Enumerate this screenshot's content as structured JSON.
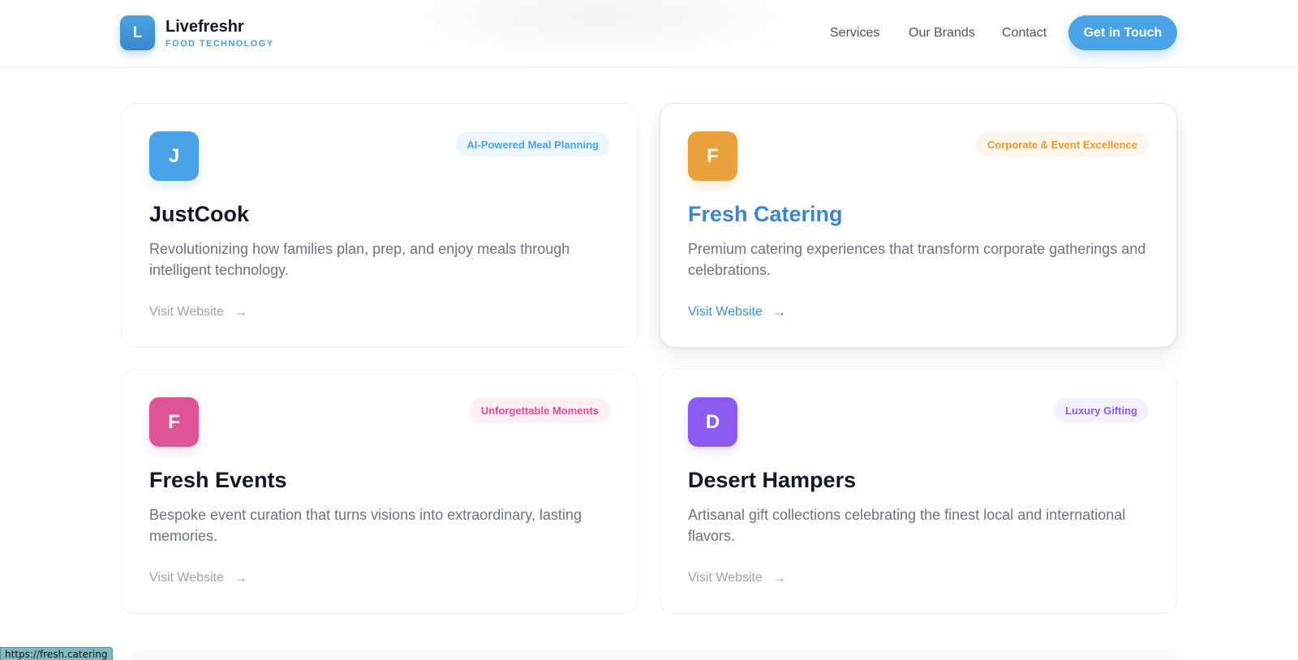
{
  "header": {
    "logo_letter": "L",
    "brand_name": "Livefreshr",
    "brand_tagline": "FOOD TECHNOLOGY",
    "nav": [
      "Services",
      "Our Brands",
      "Contact"
    ],
    "cta_label": "Get in Touch"
  },
  "cards": [
    {
      "letter": "J",
      "tag": "AI-Powered Meal Planning",
      "title": "JustCook",
      "description": "Revolutionizing how families plan, prep, and enjoy meals through intelligent technology.",
      "link": "Visit Website",
      "arrow": "→",
      "icon_color": "#4aa3e6",
      "tag_color": "#4aa3e6",
      "tag_bg": "#eef6fd",
      "state": "default"
    },
    {
      "letter": "F",
      "tag": "Corporate & Event Excellence",
      "title": "Fresh Catering",
      "description": "Premium catering experiences that transform corporate gatherings and celebrations.",
      "link": "Visit Website",
      "arrow": "→",
      "icon_color": "#e9a23b",
      "tag_color": "#e79a35",
      "tag_bg": "#fef6ea",
      "state": "hovered"
    },
    {
      "letter": "F",
      "tag": "Unforgettable Moments",
      "title": "Fresh Events",
      "description": "Bespoke event curation that turns visions into extraordinary, lasting memories.",
      "link": "Visit Website",
      "arrow": "→",
      "icon_color": "#de5596",
      "tag_color": "#d9508f",
      "tag_bg": "#fdeef4",
      "state": "default"
    },
    {
      "letter": "D",
      "tag": "Luxury Gifting",
      "title": "Desert Hampers",
      "description": "Artisanal gift collections celebrating the finest local and international flavors.",
      "link": "Visit Website",
      "arrow": "→",
      "icon_color": "#8b5cf0",
      "tag_color": "#8a5ee8",
      "tag_bg": "#f4f0fe",
      "state": "default"
    }
  ],
  "status_bar": {
    "url": "https://fresh.catering"
  }
}
